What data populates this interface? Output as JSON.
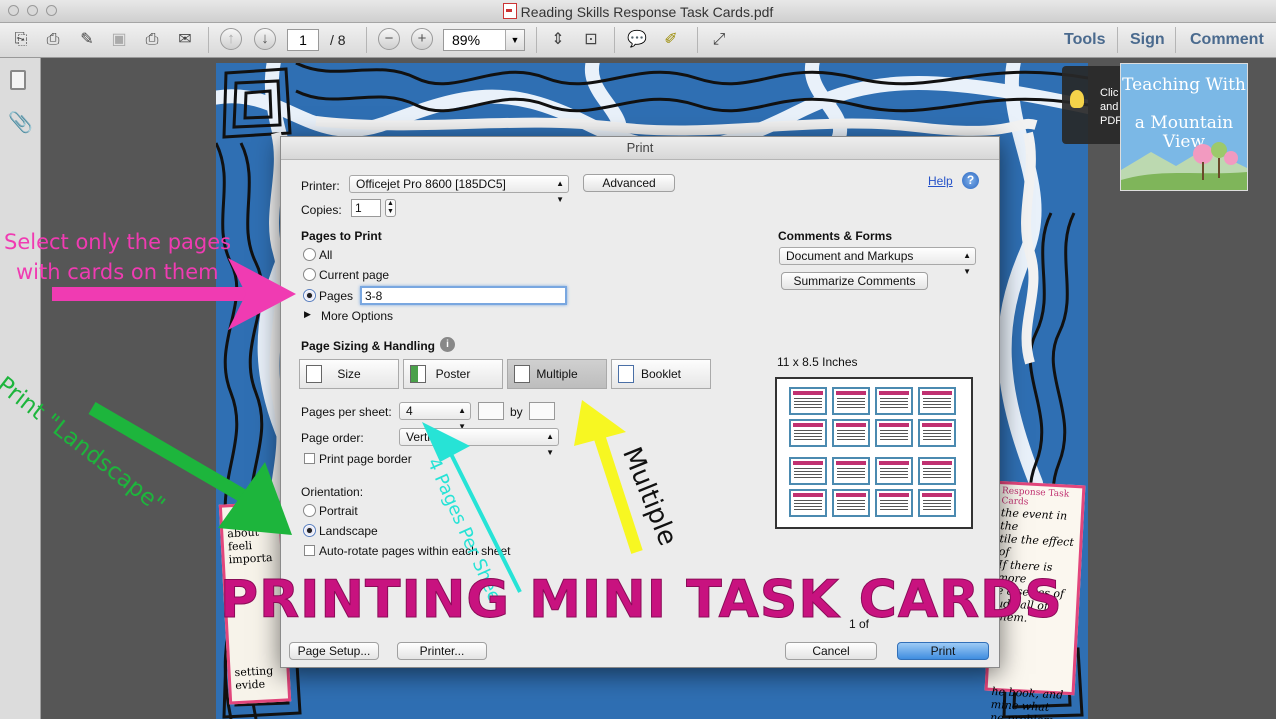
{
  "window": {
    "title": "Reading Skills Response Task Cards.pdf"
  },
  "toolbar": {
    "page_current": "1",
    "page_total": "/ 8",
    "zoom": "89%",
    "tools_label": "Tools",
    "sign_label": "Sign",
    "comment_label": "Comment"
  },
  "callout": {
    "line1": "Clic",
    "line2": "and",
    "line3": "PDF"
  },
  "brand": {
    "line1": "Teaching With",
    "line2": "a Mountain View"
  },
  "dialog": {
    "title": "Print",
    "printer_label": "Printer:",
    "printer_value": "Officejet Pro 8600 [185DC5]",
    "advanced_label": "Advanced",
    "help_label": "Help",
    "copies_label": "Copies:",
    "copies_value": "1",
    "pages_to_print_label": "Pages to Print",
    "opt_all": "All",
    "opt_current": "Current page",
    "opt_pages": "Pages",
    "pages_value": "3-8",
    "more_options": "More Options",
    "comments_forms_label": "Comments & Forms",
    "comments_forms_value": "Document and Markups",
    "summarize_label": "Summarize Comments",
    "sizing_label": "Page Sizing & Handling",
    "seg_size": "Size",
    "seg_poster": "Poster",
    "seg_multiple": "Multiple",
    "seg_booklet": "Booklet",
    "paper_size": "11 x 8.5 Inches",
    "pages_per_sheet_label": "Pages per sheet:",
    "pages_per_sheet_value": "4",
    "by_label": "by",
    "page_order_label": "Page order:",
    "page_order_value": "Verti",
    "print_border_label": "Print page border",
    "orientation_label": "Orientation:",
    "opt_portrait": "Portrait",
    "opt_landscape": "Landscape",
    "autorotate_label": "Auto-rotate pages within each sheet",
    "page_count": "1 of",
    "page_setup_label": "Page Setup...",
    "printer_btn_label": "Printer...",
    "cancel_label": "Cancel",
    "print_label": "Print"
  },
  "annotations": {
    "pink_line1": "Select only the pages",
    "pink_line2": "with cards on them",
    "green_text": "Print \"Landscape\"",
    "cyan_text": "4 Pages Per Shee",
    "yellow_text": "Multiple",
    "title": "Printing Mini task cards"
  },
  "cards_left": {
    "line1": "about",
    "line2": "feeli",
    "line3": "importa",
    "line4": "setting",
    "line5": "evide"
  },
  "cards_right": {
    "header": "Response Task Cards",
    "line1": "the event in the",
    "line2": "tile the effect of",
    "line3": "If there is more",
    "line4": "e a series of",
    "line5": "ude all of them.",
    "line6": "he book, and",
    "line7": "mine what",
    "line8": "ne problem."
  },
  "colors": {
    "pink": "#f03bb2",
    "green": "#1db53c",
    "cyan": "#27e3d6",
    "yellow": "#f7f722",
    "title": "#c8127f",
    "link": "#4a6a8e"
  }
}
